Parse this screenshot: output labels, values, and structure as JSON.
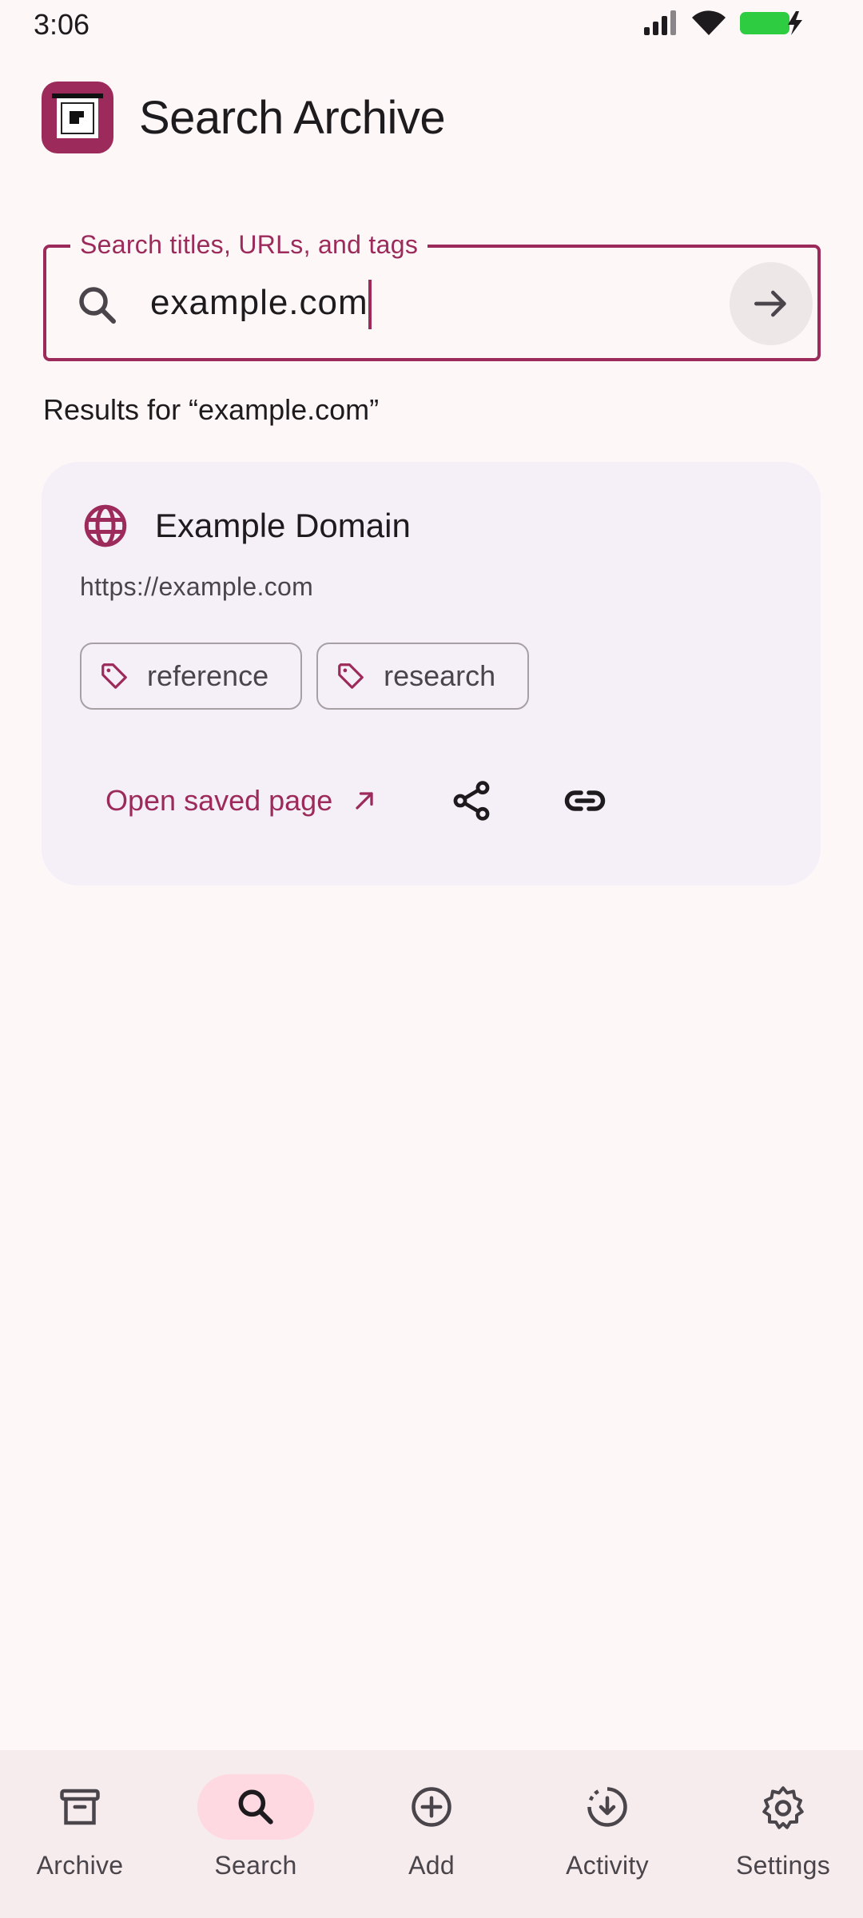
{
  "status_bar": {
    "time": "3:06"
  },
  "header": {
    "title": "Search Archive",
    "logo_icon": "archive-logo-icon"
  },
  "search": {
    "label": "Search titles, URLs, and tags",
    "value": "example.com",
    "search_icon": "search-icon",
    "go_icon": "arrow-right-icon"
  },
  "results": {
    "heading": "Results for “example.com”",
    "items": [
      {
        "title": "Example Domain",
        "url": "https://example.com",
        "icon": "globe-icon",
        "tags": [
          "reference",
          "research"
        ],
        "open_label": "Open saved page"
      }
    ]
  },
  "nav": {
    "items": [
      {
        "label": "Archive",
        "icon": "archive-icon"
      },
      {
        "label": "Search",
        "icon": "search-icon"
      },
      {
        "label": "Add",
        "icon": "add-circle-icon"
      },
      {
        "label": "Activity",
        "icon": "download-progress-icon"
      },
      {
        "label": "Settings",
        "icon": "gear-icon"
      }
    ],
    "active": "Search"
  },
  "colors": {
    "primary": "#9C2A5A",
    "background": "#FEF7F7",
    "card": "#F5F0F8",
    "nav_background": "#F6ECEE",
    "nav_active_pill": "#FFD9E2",
    "battery": "#2ECC40"
  }
}
